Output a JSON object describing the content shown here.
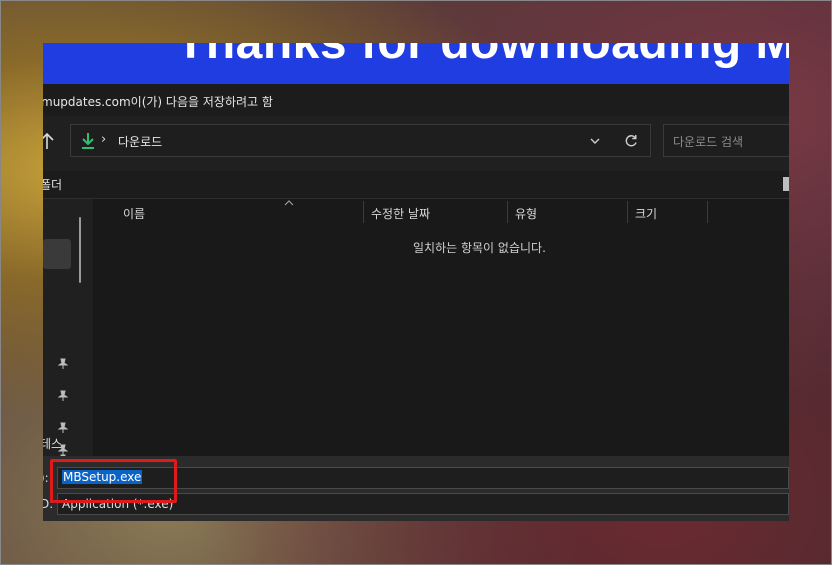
{
  "banner": {
    "text": "Thanks for downloading M"
  },
  "dialog": {
    "title": "mupdates.com이(가) 다음을 저장하려고 함"
  },
  "address_bar": {
    "path": "다운로드",
    "separator": "›"
  },
  "search": {
    "placeholder": "다운로드 검색"
  },
  "toolbar": {
    "label_fragment": "폴더"
  },
  "sidebar": {
    "item_fragment": "테스"
  },
  "file_list": {
    "columns": [
      "이름",
      "수정한 날짜",
      "유형",
      "크기"
    ],
    "empty_message": "일치하는 항목이 없습니다."
  },
  "save_panel": {
    "filename_label": "):",
    "filename_value": "MBSetup.exe",
    "filetype_label": "D:",
    "filetype_value": "Application (*.exe)"
  },
  "colors": {
    "banner": "#1f3de0",
    "selection": "#0a64c8",
    "highlight": "#e0191b",
    "download_icon": "#2fbf71"
  },
  "icons": [
    "up-arrow-icon",
    "download-icon",
    "chevron-right-icon",
    "chevron-down-icon",
    "refresh-icon",
    "view-toggle-icon",
    "pin-icon",
    "sort-up-icon"
  ]
}
